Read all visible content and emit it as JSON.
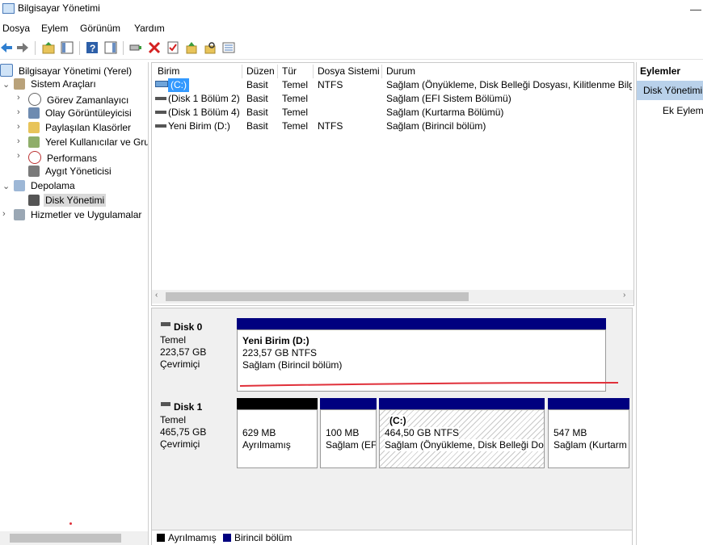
{
  "window": {
    "title": "Bilgisayar Yönetimi"
  },
  "menu": [
    "Dosya",
    "Eylem",
    "Görünüm",
    "Yardım"
  ],
  "toolbar_icons": [
    "back-arrow-icon",
    "forward-arrow-icon",
    "up-folder-icon",
    "show-hide-tree-icon",
    "help-icon",
    "show-hide-action-icon",
    "connect-drive-icon",
    "delete-icon",
    "properties-icon",
    "import-icon",
    "search-icon",
    "list-view-icon"
  ],
  "tree": {
    "root": "Bilgisayar Yönetimi (Yerel)",
    "system_tools": "Sistem Araçları",
    "task_scheduler": "Görev Zamanlayıcı",
    "event_viewer": "Olay Görüntüleyicisi",
    "shared_folders": "Paylaşılan Klasörler",
    "local_users": "Yerel Kullanıcılar ve Gru",
    "performance": "Performans",
    "device_manager": "Aygıt Yöneticisi",
    "storage": "Depolama",
    "disk_management": "Disk Yönetimi",
    "services": "Hizmetler ve Uygulamalar"
  },
  "volume_list": {
    "columns": [
      "Birim",
      "Düzen",
      "Tür",
      "Dosya Sistemi",
      "Durum"
    ],
    "rows": [
      {
        "volume": "(C:)",
        "layout": "Basit",
        "type": "Temel",
        "fs": "NTFS",
        "status": "Sağlam (Önyükleme, Disk Belleği Dosyası, Kilitlenme Bilgisi"
      },
      {
        "volume": "(Disk 1 Bölüm 2)",
        "layout": "Basit",
        "type": "Temel",
        "fs": "",
        "status": "Sağlam (EFI Sistem Bölümü)"
      },
      {
        "volume": "(Disk 1 Bölüm 4)",
        "layout": "Basit",
        "type": "Temel",
        "fs": "",
        "status": "Sağlam (Kurtarma Bölümü)"
      },
      {
        "volume": "Yeni Birim (D:)",
        "layout": "Basit",
        "type": "Temel",
        "fs": "NTFS",
        "status": "Sağlam (Birincil bölüm)"
      }
    ]
  },
  "disks": [
    {
      "name": "Disk 0",
      "type": "Temel",
      "size": "223,57 GB",
      "state": "Çevrimiçi",
      "partitions": [
        {
          "title": "Yeni Birim  (D:)",
          "line2": "223,57 GB NTFS",
          "line3": "Sağlam (Birincil bölüm)"
        }
      ]
    },
    {
      "name": "Disk 1",
      "type": "Temel",
      "size": "465,75 GB",
      "state": "Çevrimiçi",
      "partitions": [
        {
          "title": "",
          "line2": "629 MB",
          "line3": "Ayrılmamış"
        },
        {
          "title": "",
          "line2": "100 MB",
          "line3": "Sağlam (EF"
        },
        {
          "title": "(C:)",
          "line2": "464,50 GB NTFS",
          "line3": "Sağlam (Önyükleme, Disk Belleği Dos"
        },
        {
          "title": "",
          "line2": "547 MB",
          "line3": "Sağlam (Kurtarm"
        }
      ]
    }
  ],
  "legend": {
    "unallocated": "Ayrılmamış",
    "primary": "Birincil bölüm"
  },
  "actions": {
    "header": "Eylemler",
    "section": "Disk Yönetimi",
    "more": "Ek Eylemler"
  },
  "colors": {
    "primary_partition": "#00007f",
    "unallocated": "#000000",
    "annotation_red": "#e0303a",
    "selection": "#3399ff"
  }
}
